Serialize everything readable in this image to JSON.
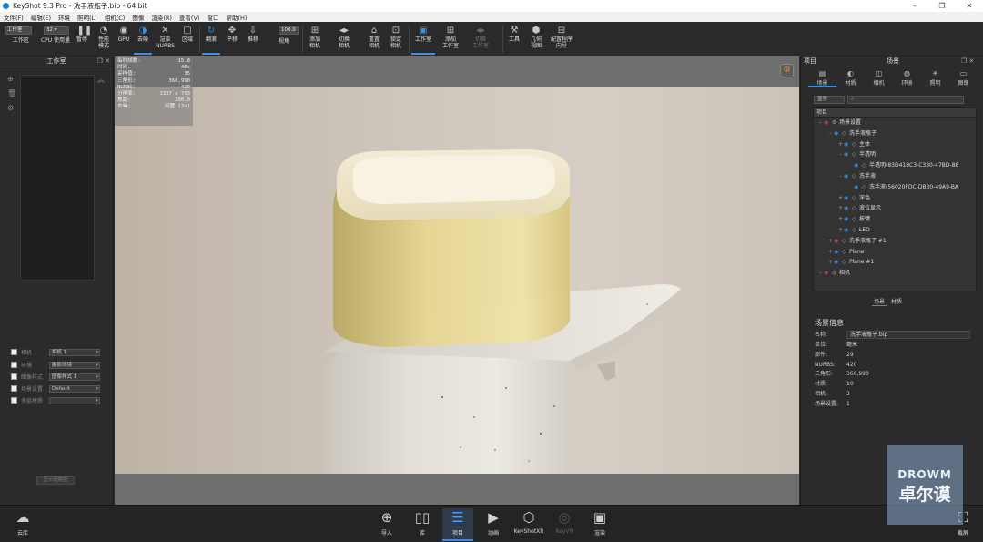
{
  "window": {
    "title": "KeyShot 9.3 Pro - 洗手液瓶子.bip - 64 bit",
    "controls": [
      "–",
      "❐",
      "✕"
    ]
  },
  "menu": [
    "文件(F)",
    "编辑(E)",
    "环境",
    "照明(L)",
    "相机(C)",
    "图像",
    "渲染(R)",
    "查看(V)",
    "窗口",
    "帮助(H)"
  ],
  "toolbar": {
    "workspace_select": "工作室",
    "cpu_select": "32 ▾",
    "zoom_value": "100.0",
    "buttons": {
      "workspace": "工作区",
      "cpu_usage": "CPU 使用量",
      "pause": "暂停",
      "perf_mode": "性能\n模式",
      "gpu": "GPU",
      "denoise": "去噪",
      "render_nurbs": "渲染\nNURBS",
      "region": "区域",
      "tumble": "翻滚",
      "pan": "平移",
      "dolly": "推移",
      "fov": "视角",
      "add_camera": "添加\n相机",
      "switch_camera": "切换\n相机",
      "reset_camera": "重置\n相机",
      "lock_camera": "锁定\n相机",
      "studio": "工作室",
      "add_studio": "添加\n工作室",
      "switch_studio": "切换\n工作室",
      "tools": "工具",
      "geometry_view": "几何\n视图",
      "config_wizard": "配置程序\n向导"
    }
  },
  "left_panel": {
    "title": "工作室",
    "rows": [
      {
        "label": "相机",
        "value": "相机 1"
      },
      {
        "label": "环境",
        "value": "摄影环境"
      },
      {
        "label": "图像样式",
        "value": "图像样式 1"
      },
      {
        "label": "场景设置",
        "value": "Default"
      },
      {
        "label": "多层材质",
        "value": ""
      }
    ],
    "bottom_button": "显示缩略图"
  },
  "viewport": {
    "stats": [
      {
        "k": "每秒帧数:",
        "v": "15.8"
      },
      {
        "k": "时间:",
        "v": "46s"
      },
      {
        "k": "采样值:",
        "v": "35"
      },
      {
        "k": "三角形:",
        "v": "366,990"
      },
      {
        "k": "NURBS:",
        "v": "420"
      },
      {
        "k": "分辨率:",
        "v": "1337 x 753"
      },
      {
        "k": "焦距:",
        "v": "100.0"
      },
      {
        "k": "去噪:",
        "v": "闲置 (3s)"
      }
    ]
  },
  "right_panel": {
    "header_left": "项目",
    "header_center": "场景",
    "tabs": [
      "场景",
      "材质",
      "相机",
      "环境",
      "照明",
      "图像"
    ],
    "filter_select": "显示",
    "search_placeholder": "",
    "tree_header": "项目",
    "tree": [
      {
        "indent": 0,
        "toggle": "–",
        "eye": false,
        "icon": "⚙",
        "label": "场景设置"
      },
      {
        "indent": 1,
        "toggle": "–",
        "eye": true,
        "icon": "◇",
        "label": "洗手液瓶子"
      },
      {
        "indent": 2,
        "toggle": "+",
        "eye": true,
        "icon": "◇",
        "label": "主体"
      },
      {
        "indent": 2,
        "toggle": "–",
        "eye": true,
        "icon": "◇",
        "label": "半透明"
      },
      {
        "indent": 3,
        "toggle": "",
        "eye": true,
        "icon": "◇",
        "label": "半透明(83D418C3-C330-47BD-88"
      },
      {
        "indent": 2,
        "toggle": "–",
        "eye": true,
        "icon": "◇",
        "label": "洗手液"
      },
      {
        "indent": 3,
        "toggle": "",
        "eye": true,
        "icon": "◇",
        "label": "洗手液(56020FDC-DB30-49A9-BA"
      },
      {
        "indent": 2,
        "toggle": "+",
        "eye": true,
        "icon": "◇",
        "label": "深色"
      },
      {
        "indent": 2,
        "toggle": "+",
        "eye": true,
        "icon": "◇",
        "label": "液位显示"
      },
      {
        "indent": 2,
        "toggle": "+",
        "eye": true,
        "icon": "◇",
        "label": "按键"
      },
      {
        "indent": 2,
        "toggle": "+",
        "eye": true,
        "icon": "◇",
        "label": "LED"
      },
      {
        "indent": 1,
        "toggle": "+",
        "eye": false,
        "icon": "◇",
        "label": "洗手液瓶子 #1"
      },
      {
        "indent": 1,
        "toggle": "+",
        "eye": true,
        "icon": "◇",
        "label": "Plane"
      },
      {
        "indent": 1,
        "toggle": "+",
        "eye": true,
        "icon": "◇",
        "label": "Plane #1"
      },
      {
        "indent": 0,
        "toggle": "–",
        "eye": false,
        "icon": "◎",
        "label": "相机"
      }
    ],
    "bottom_tabs": [
      "场景",
      "材质"
    ],
    "info_title": "场景信息",
    "info": {
      "name_label": "名称:",
      "name_value": "洗手液瓶子.bip",
      "rows": [
        {
          "k": "单位:",
          "v": "毫米"
        },
        {
          "k": "部件:",
          "v": "29"
        },
        {
          "k": "NURBS:",
          "v": "420"
        },
        {
          "k": "三角形:",
          "v": "366,990"
        },
        {
          "k": "材质:",
          "v": "10"
        },
        {
          "k": "相机:",
          "v": "2"
        },
        {
          "k": "场景设置:",
          "v": "1"
        }
      ]
    }
  },
  "bottom_bar": {
    "cloud": "云库",
    "import": "导入",
    "library": "库",
    "project": "项目",
    "animation": "动画",
    "keyshotxr": "KeyShotXR",
    "keyvr": "KeyVR",
    "render": "渲染",
    "screenshot": "截屏"
  },
  "watermark": {
    "line1": "DROWM",
    "line2": "卓尔谟"
  }
}
